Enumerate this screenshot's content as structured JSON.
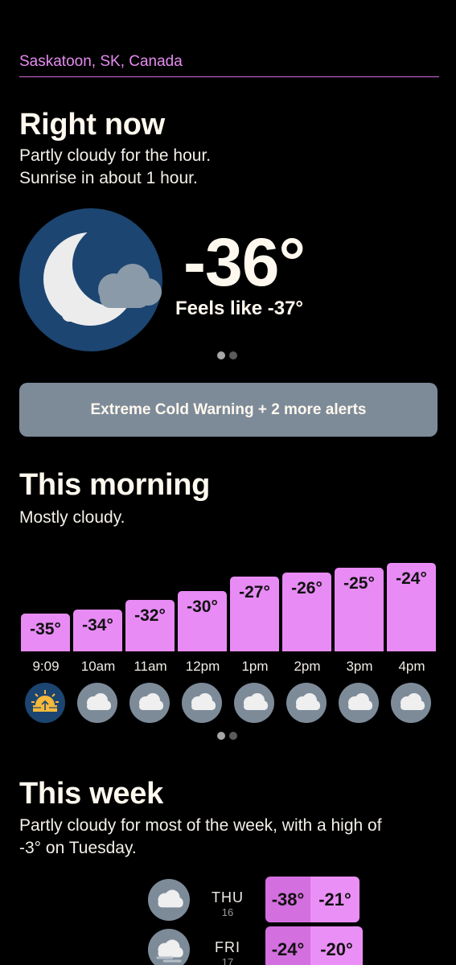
{
  "location": "Saskatoon, SK, Canada",
  "now": {
    "title": "Right now",
    "summary_line1": "Partly cloudy for the hour.",
    "summary_line2": "Sunrise in about 1 hour.",
    "icon": "night-partly-cloudy-icon",
    "temperature": "-36°",
    "feels_like": "Feels like -37°",
    "page_count": 2,
    "page_active": 0
  },
  "alert": {
    "label": "Extreme Cold Warning + 2 more alerts"
  },
  "morning": {
    "title": "This morning",
    "summary": "Mostly cloudy.",
    "hours": [
      {
        "time": "9:09",
        "temp": "-35°",
        "value": -35,
        "icon": "sunrise-icon"
      },
      {
        "time": "10am",
        "temp": "-34°",
        "value": -34,
        "icon": "cloud-icon"
      },
      {
        "time": "11am",
        "temp": "-32°",
        "value": -32,
        "icon": "cloud-icon"
      },
      {
        "time": "12pm",
        "temp": "-30°",
        "value": -30,
        "icon": "cloud-icon"
      },
      {
        "time": "1pm",
        "temp": "-27°",
        "value": -27,
        "icon": "cloud-icon"
      },
      {
        "time": "2pm",
        "temp": "-26°",
        "value": -26,
        "icon": "cloud-icon"
      },
      {
        "time": "3pm",
        "temp": "-25°",
        "value": -25,
        "icon": "cloud-icon"
      },
      {
        "time": "4pm",
        "temp": "-24°",
        "value": -24,
        "icon": "cloud-icon"
      }
    ]
  },
  "week": {
    "title": "This week",
    "summary_line1": "Partly cloudy for most of the week, with a high of",
    "summary_line2": "-3° on Tuesday.",
    "days": [
      {
        "day": "THU",
        "date": "16",
        "low": "-38°",
        "high": "-21°",
        "icon": "cloud-icon"
      },
      {
        "day": "FRI",
        "date": "17",
        "low": "-24°",
        "high": "-20°",
        "icon": "fog-cloud-icon"
      }
    ]
  },
  "colors": {
    "accent": "#e88bf5",
    "alert_bg": "#7d8b99",
    "icon_bg_night": "#1c4571",
    "icon_bg_cloud": "#7d8b99"
  }
}
